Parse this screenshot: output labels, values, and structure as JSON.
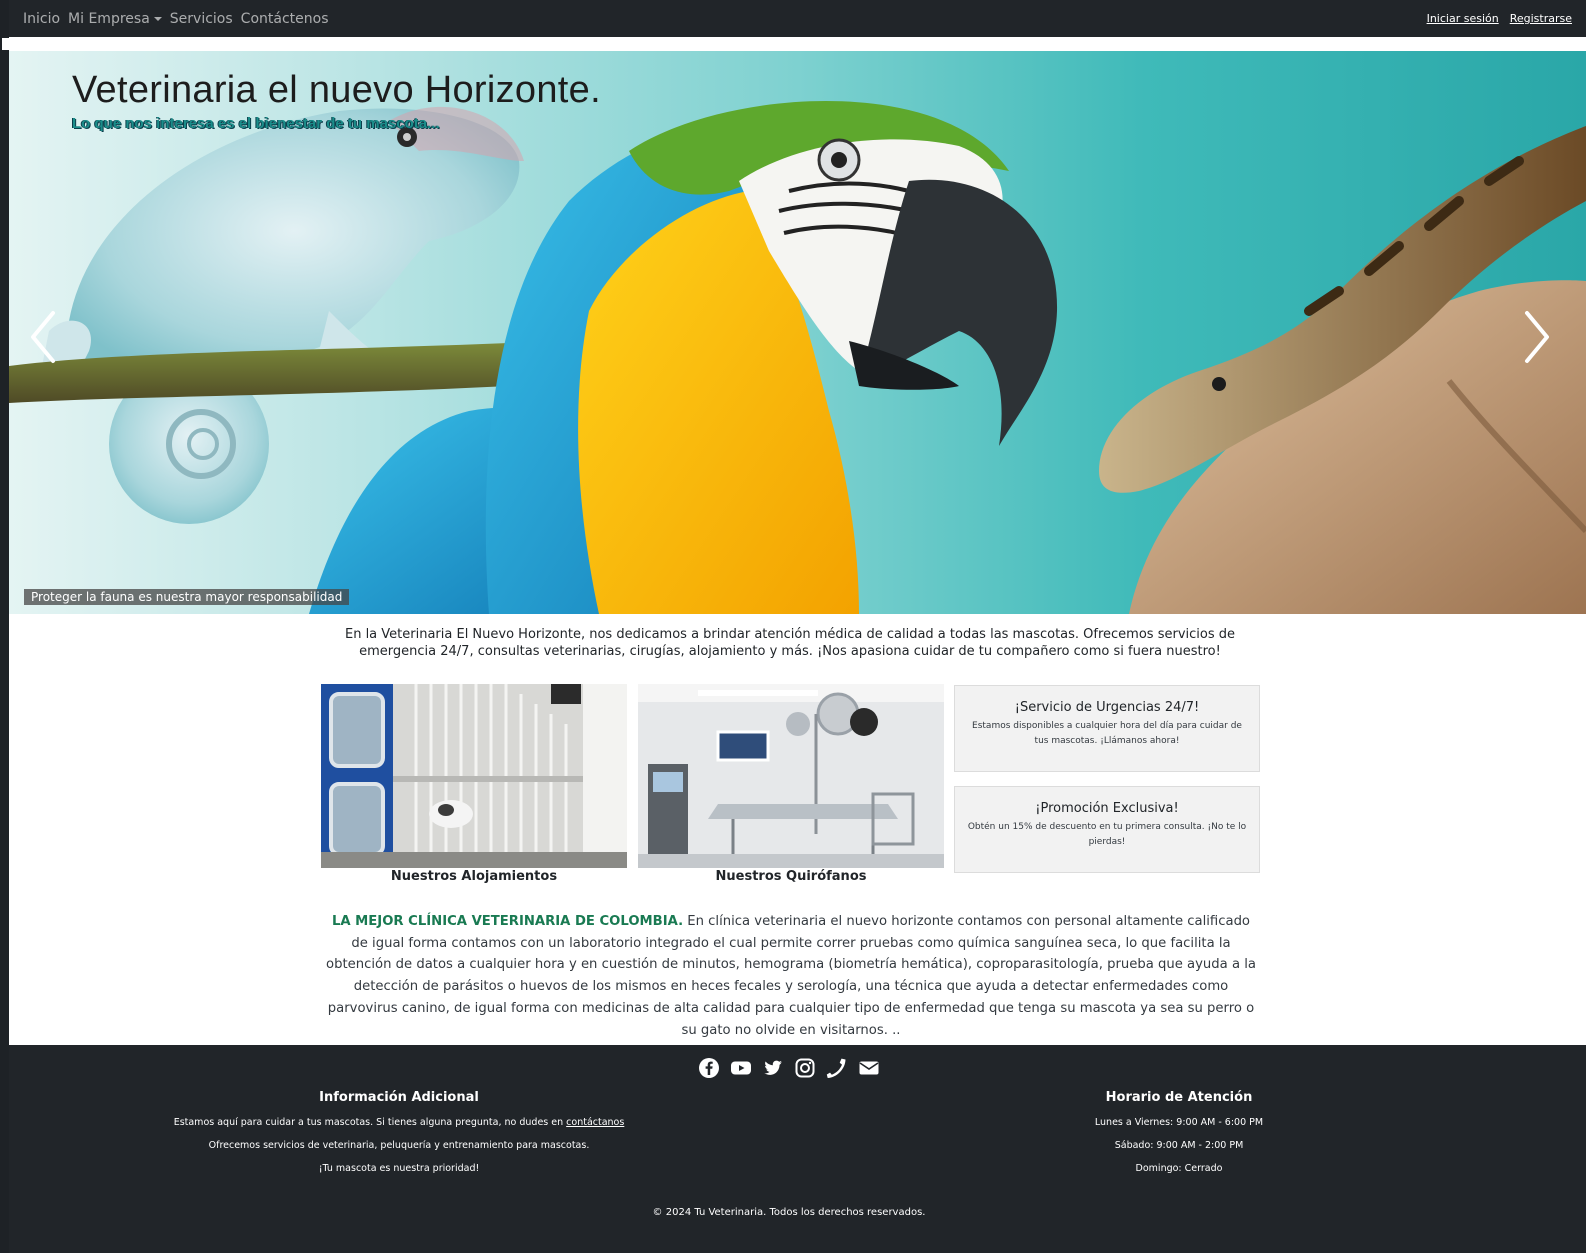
{
  "navbar": {
    "links": [
      "Inicio",
      "Mi Empresa",
      "Servicios",
      "Contáctenos"
    ],
    "login": "Iniciar sesión",
    "register": "Registrarse"
  },
  "hero": {
    "title": "Veterinaria el nuevo Horizonte.",
    "subtitle": "Lo que nos interesa es el bienestar de tu mascota...",
    "caption": "Proteger la fauna es nuestra mayor responsabilidad",
    "prev_icon": "chevron-left-icon",
    "next_icon": "chevron-right-icon"
  },
  "intro": "En la Veterinaria El Nuevo Horizonte, nos dedicamos a brindar atención médica de calidad a todas las mascotas. Ofrecemos servicios de emergencia 24/7, consultas veterinarias, cirugías, alojamiento y más. ¡Nos apasiona cuidar de tu compañero como si fuera nuestro!",
  "gallery": {
    "alojamientos": "Nuestros Alojamientos",
    "quirofanos": "Nuestros Quirófanos"
  },
  "promos": [
    {
      "title": "¡Servicio de Urgencias 24/7!",
      "text": "Estamos disponibles a cualquier hora del día para cuidar de tus mascotas. ¡Llámanos ahora!"
    },
    {
      "title": "¡Promoción Exclusiva!",
      "text": "Obtén un 15% de descuento en tu primera consulta. ¡No te lo pierdas!"
    }
  ],
  "about": {
    "lead": "LA MEJOR CLÍNICA VETERINARIA DE COLOMBIA.",
    "text": " En clínica veterinaria el nuevo horizonte contamos con personal altamente calificado de igual forma contamos con un laboratorio integrado el cual permite correr pruebas como química sanguínea seca, lo que facilita la obtención de datos a cualquier hora y en cuestión de minutos, hemograma (biometría hemática), coproparasitología, prueba que ayuda a la detección de parásitos o huevos de los mismos en heces fecales y serología, una técnica que ayuda a detectar enfermedades como parvovirus canino, de igual forma con medicinas de alta calidad para cualquier tipo de enfermedad que tenga su mascota ya sea su perro o su gato no olvide en visitarnos. .."
  },
  "footer": {
    "social_icons": [
      "facebook-icon",
      "youtube-icon",
      "twitter-icon",
      "instagram-icon",
      "phone-icon",
      "envelope-icon"
    ],
    "info": {
      "title": "Información Adicional",
      "line1": "Estamos aquí para cuidar a tus mascotas. Si tienes alguna pregunta, no dudes en",
      "line1_link": "contáctanos",
      "line2": "Ofrecemos servicios de veterinaria, peluquería y entrenamiento para mascotas.",
      "line3": "¡Tu mascota es nuestra prioridad!"
    },
    "hours": {
      "title": "Horario de Atención",
      "weekdays": "Lunes a Viernes: 9:00 AM - 6:00 PM",
      "saturday": "Sábado: 9:00 AM - 2:00 PM",
      "sunday": "Domingo: Cerrado"
    },
    "copyright": "© 2024 Tu Veterinaria. Todos los derechos reservados."
  },
  "colors": {
    "navbar": "#212529",
    "accent_green": "#197a52",
    "hero_teal": "#2aa7a8"
  }
}
